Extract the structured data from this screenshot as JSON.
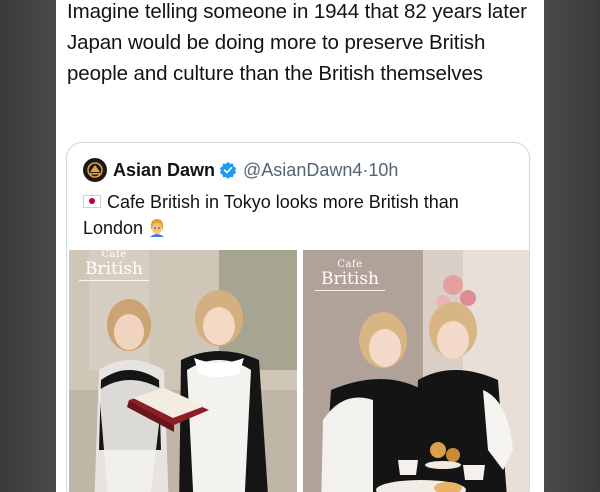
{
  "post": {
    "text": "Imagine telling someone in 1944 that 82 years later Japan would be doing more to preserve British people and culture than the British themselves"
  },
  "quoted_post": {
    "author_name": "Asian Dawn",
    "handle": "@AsianDawn4",
    "separator": "·",
    "time": "10h",
    "text": "Cafe British in Tokyo looks more British than London",
    "icons": [
      "verified-badge-icon",
      "japan-flag-icon",
      "person-emoji-icon"
    ],
    "accent_color": "#1d9bf0"
  },
  "images": [
    {
      "logo_cafe": "Cafe",
      "logo_brand": "British"
    },
    {
      "logo_cafe": "Cafe",
      "logo_brand": "British"
    }
  ]
}
